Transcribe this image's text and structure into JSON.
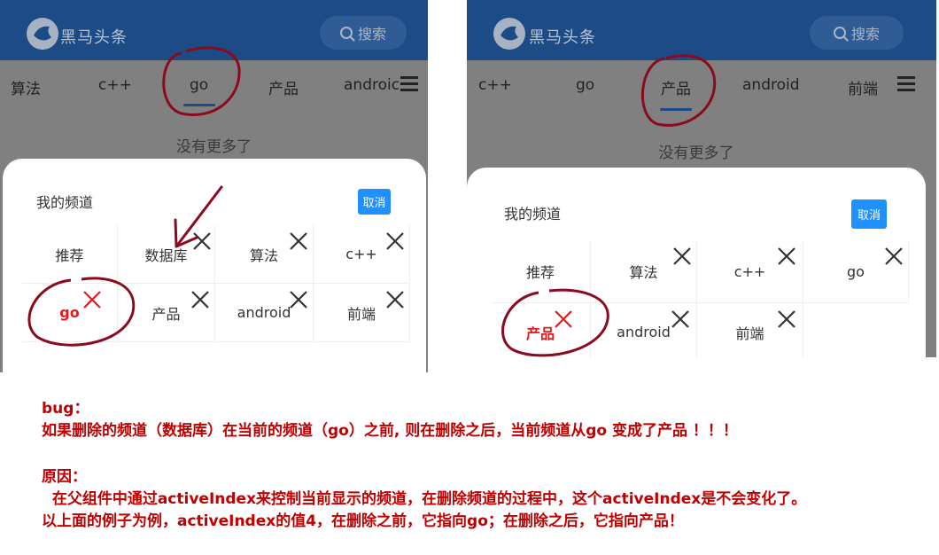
{
  "left_screen": {
    "app_title": "黑马头条",
    "search_label": "搜索",
    "tabs": [
      "算法",
      "c++",
      "go",
      "产品",
      "androic"
    ],
    "empty_text": "没有更多了",
    "popup": {
      "title": "我的频道",
      "cancel_label": "取消",
      "channels": [
        "推荐",
        "数据库",
        "算法",
        "c++",
        "go",
        "产品",
        "android",
        "前端"
      ]
    }
  },
  "right_screen": {
    "app_title": "黑马头条",
    "search_label": "搜索",
    "tabs": [
      "c++",
      "go",
      "产品",
      "android",
      "前端"
    ],
    "empty_text": "没有更多了",
    "popup": {
      "title": "我的频道",
      "cancel_label": "取消",
      "channels": [
        "推荐",
        "算法",
        "c++",
        "go",
        "产品",
        "android",
        "前端"
      ]
    }
  },
  "notes": {
    "bug_heading": "bug：",
    "bug_text": "如果删除的频道（数据库）在当前的频道（go）之前, 则在删除之后，当前频道从go 变成了产品 ！！！",
    "cause_heading": "原因：",
    "cause_line1": "  在父组件中通过activeIndex来控制当前显示的频道，在删除频道的过程中，这个activeIndex是不会变化了。",
    "cause_line2": "以上面的例子为例，activeIndex的值4，在删除之前，它指向go；在删除之后，它指向产品！"
  },
  "colors": {
    "appbar": "#1c4b86",
    "overlay": "#808080",
    "cancel_button": "#1e90ff",
    "note_text": "#c00000",
    "annotation_ink": "#8b0b1e",
    "current_channel": "#e8191c"
  }
}
